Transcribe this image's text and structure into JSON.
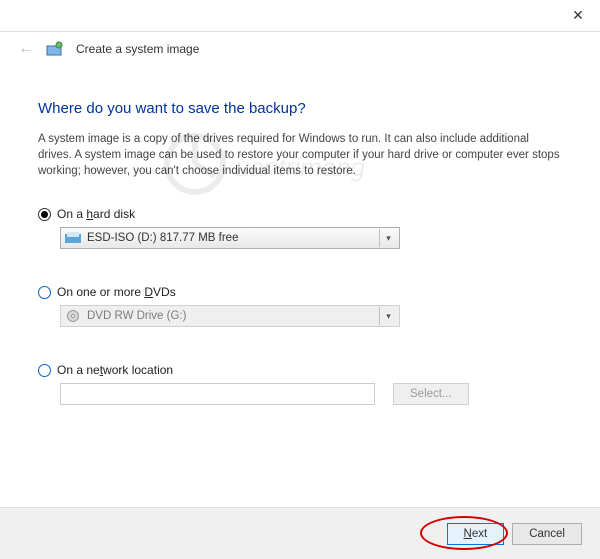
{
  "titlebar": {
    "close": "✕"
  },
  "header": {
    "back": "←",
    "title": "Create a system image"
  },
  "heading": "Where do you want to save the backup?",
  "description": "A system image is a copy of the drives required for Windows to run. It can also include additional drives. A system image can be used to restore your computer if your hard drive or computer ever stops working; however, you can't choose individual items to restore.",
  "options": {
    "hard_disk": {
      "label_pre": "On a ",
      "label_key": "h",
      "label_post": "ard disk",
      "combo": "ESD-ISO (D:)  817.77 MB free"
    },
    "dvds": {
      "label_pre": "On one or more ",
      "label_key": "D",
      "label_post": "VDs",
      "combo": "DVD RW Drive (G:)"
    },
    "network": {
      "label_pre": "On a ne",
      "label_key": "t",
      "label_post": "work location",
      "select_btn": "Select..."
    }
  },
  "footer": {
    "next_key": "N",
    "next_post": "ext",
    "cancel": "Cancel"
  }
}
